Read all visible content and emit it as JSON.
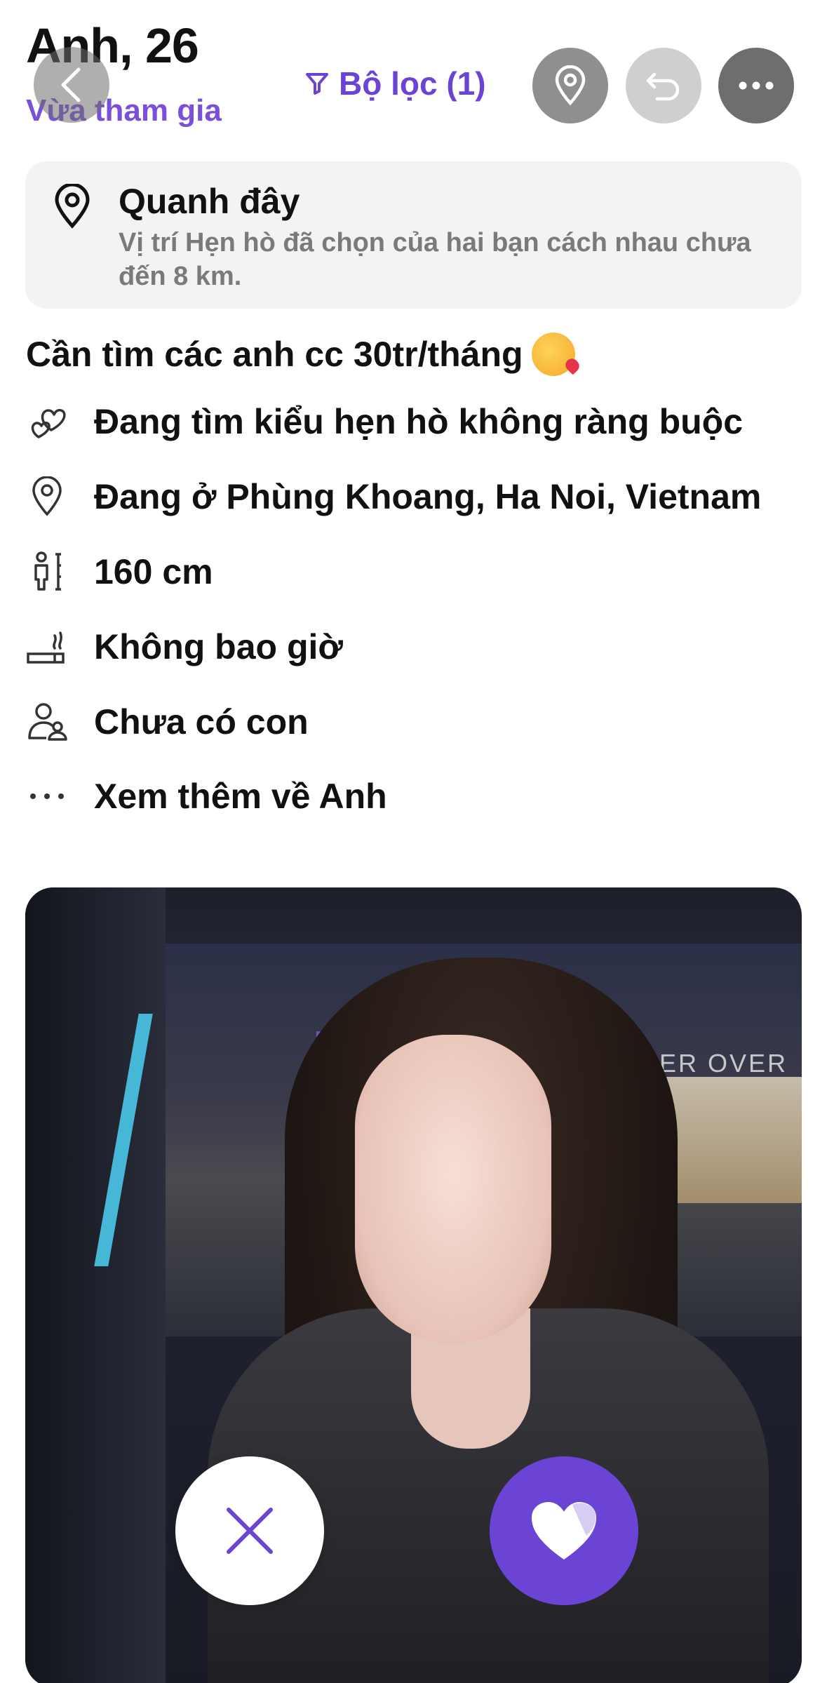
{
  "header": {
    "name": "Anh, 26",
    "subtitle": "Vừa tham gia",
    "filter_label": "Bộ lọc (1)"
  },
  "nearby": {
    "title": "Quanh đây",
    "description": "Vị trí Hẹn hò đã chọn của hai bạn cách nhau chưa đến 8 km."
  },
  "bio": "Cần tìm các anh cc 30tr/tháng",
  "details": [
    {
      "icon": "hearts-icon",
      "text": "Đang tìm kiểu hẹn hò không ràng buộc"
    },
    {
      "icon": "location-pin-icon",
      "text": "Đang ở Phùng Khoang, Ha Noi, Vietnam"
    },
    {
      "icon": "height-icon",
      "text": "160 cm"
    },
    {
      "icon": "smoking-icon",
      "text": "Không bao giờ"
    },
    {
      "icon": "children-icon",
      "text": "Chưa có con"
    },
    {
      "icon": "more-dots-icon",
      "text": "Xem thêm về Anh"
    }
  ],
  "photo": {
    "store_sign": "UNDER OVER"
  },
  "colors": {
    "accent": "#6b44d6",
    "accent_light": "#7a4fd9"
  }
}
